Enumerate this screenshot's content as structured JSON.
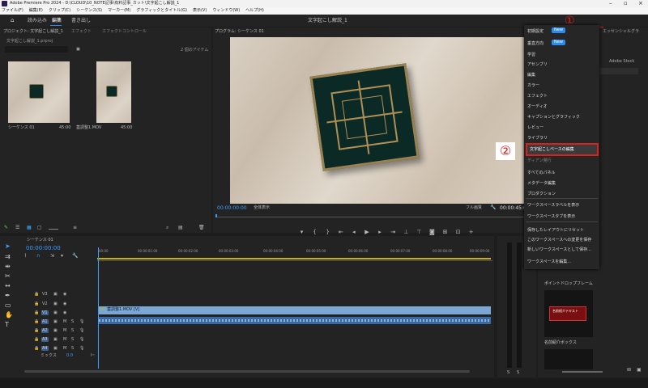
{
  "window": {
    "title": "Adobe Premiere Pro 2024 - D:\\CLOUD\\10_NOTE記事\\有料記事_カット\\文字起こし解説_1"
  },
  "menu": [
    "ファイル(F)",
    "編集(E)",
    "クリップ(C)",
    "シーケンス(S)",
    "マーカー(M)",
    "グラフィックとタイトル(G)",
    "表示(V)",
    "ウィンドウ(W)",
    "ヘルプ(H)"
  ],
  "workspace": {
    "tabs": [
      "読み込み",
      "編集",
      "書き出し"
    ],
    "active_tab": "編集",
    "center_title": "文字起こし解説_1"
  },
  "callouts": {
    "one": "①",
    "two": "②"
  },
  "project_panel": {
    "tabs": [
      "プロジェクト: 文字起こし解説_1",
      "エフェクト",
      "エフェクトコントロール"
    ],
    "file": "文字起こし解説_1.prproj",
    "item_count": "2 個のアイテム",
    "items": [
      {
        "name": "シーケンス 01",
        "duration": "45:00"
      },
      {
        "name": "蓋調整1.MOV",
        "duration": "45:00"
      }
    ]
  },
  "program_monitor": {
    "title": "プログラム: シーケンス 01",
    "timecode": "00:00:00:00",
    "fit": "全体表示",
    "quality": "フル画質",
    "end_timecode": "00:00:45:00"
  },
  "timeline": {
    "title": "シーケンス 01",
    "timecode": "00:00:00:00",
    "ruler": [
      "00:00",
      "00:00:01:00",
      "00:00:02:00",
      "00:00:03:00",
      "00:00:04:00",
      "00:00:05:00",
      "00:00:06:00",
      "00:00:07:00",
      "00:00:08:00",
      "00:00:09:00"
    ],
    "video_tracks": [
      "V3",
      "V2",
      "V1"
    ],
    "audio_tracks": [
      "A1",
      "A2",
      "A3",
      "A4"
    ],
    "mix_label": "ミックス",
    "mix_value": "0.0",
    "clip_name": "蓋調整1.MOV [V]"
  },
  "workspace_menu": {
    "toggles": [
      {
        "label": "初期設定",
        "state": "New"
      },
      {
        "label": "垂直方向",
        "state": "New"
      }
    ],
    "items": [
      "学習",
      "アセンブリ",
      "編集",
      "カラー",
      "エフェクト",
      "オーディオ",
      "キャプションとグラフィック",
      "レビュー",
      "ライブラリ",
      "文字起こしベースの編集",
      "すべてのパネル",
      "メタデータ編集",
      "プロダクション",
      "ワークスペースラベルを表示",
      "ワークスペースタブを表示",
      "保存したレイアウトにリセット",
      "このワークスペースへの変更を保存",
      "新しいワークスペースとして保存...",
      "ワークスペースを編集..."
    ],
    "highlighted": "文字起こしベースの編集",
    "hidden_item": "ディアン発行"
  },
  "essential_graphics": {
    "title": "エッセンシャルグラ",
    "stock": "Adobe Stock",
    "cards": [
      "ポイントドロップフレーム",
      "名前紹介ボックス"
    ],
    "card_text": "名前紹介テキスト"
  }
}
